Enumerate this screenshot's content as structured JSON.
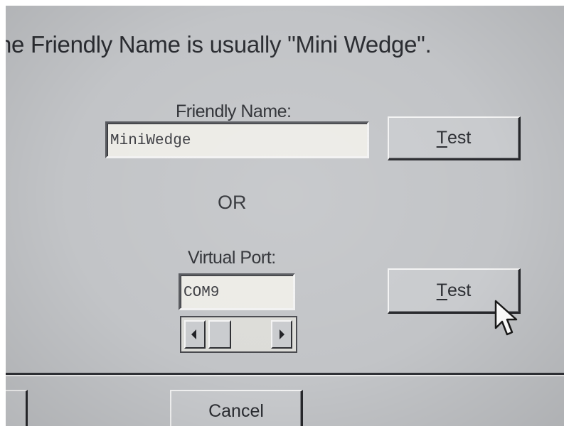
{
  "dialog": {
    "intro_text": "he Friendly Name is usually \"Mini Wedge\".",
    "separator_text": "OR"
  },
  "friendly_name": {
    "label": "Friendly Name:",
    "value": "MiniWedge",
    "test_button": {
      "mnemonic": "T",
      "rest": "est"
    }
  },
  "virtual_port": {
    "label": "Virtual Port:",
    "value": "COM9",
    "test_button": {
      "mnemonic": "T",
      "rest": "est"
    },
    "scroll_left_icon": "triangle-left",
    "scroll_right_icon": "triangle-right"
  },
  "footer": {
    "cancel_label": "Cancel"
  },
  "colors": {
    "face": "#c2c4c7",
    "field": "#ecebe6",
    "text": "#2a2c31"
  }
}
